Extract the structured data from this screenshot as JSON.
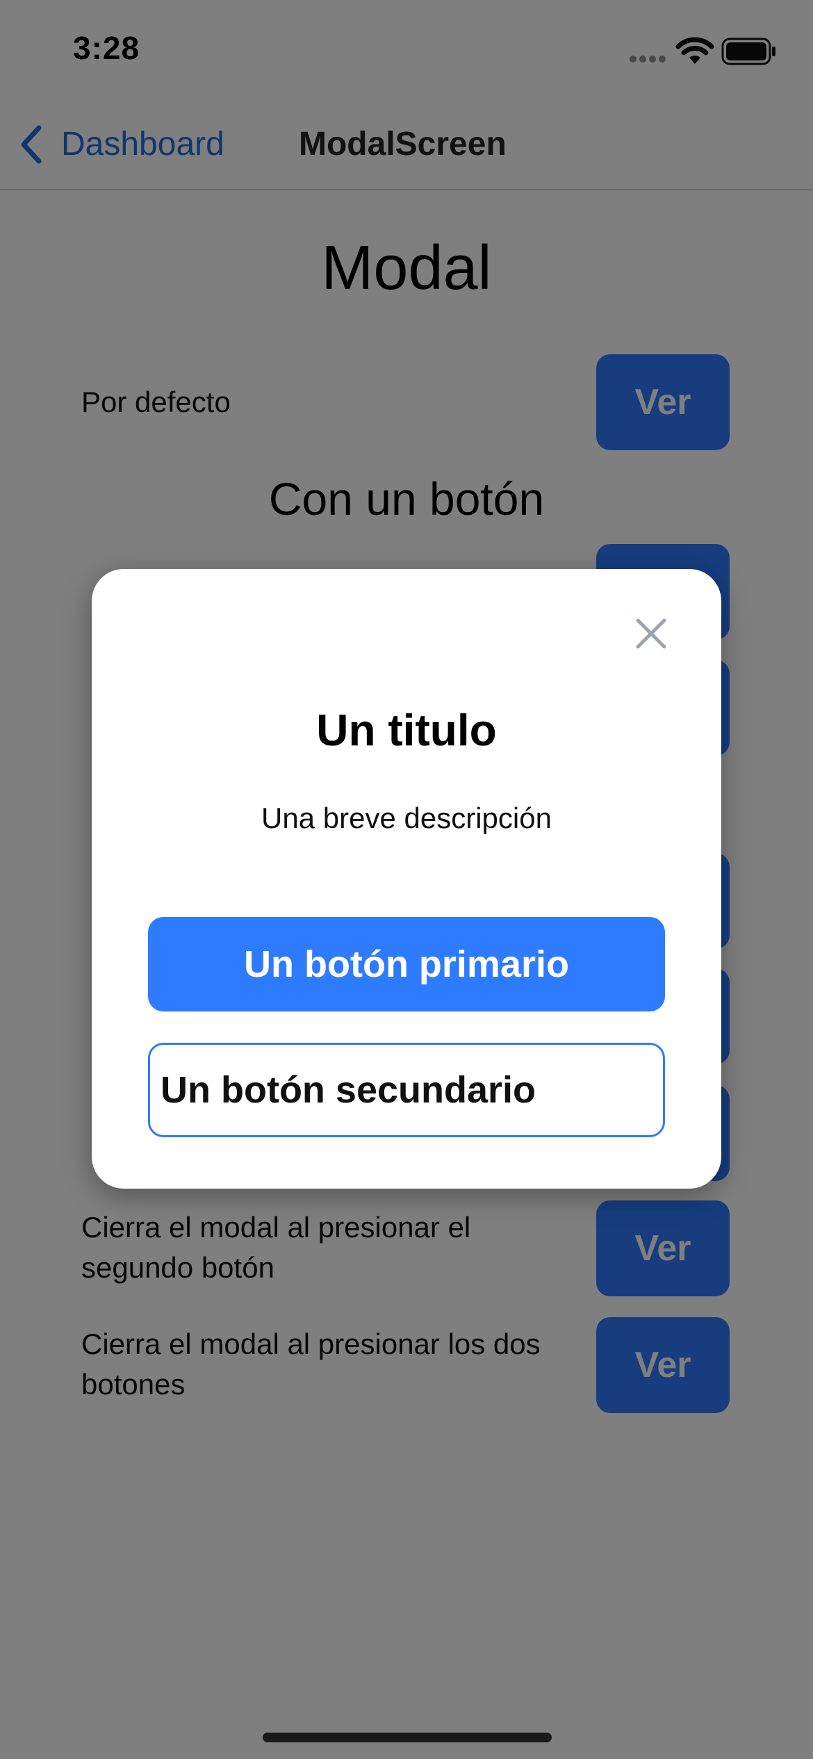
{
  "status_bar": {
    "time": "3:28"
  },
  "nav": {
    "back_label": "Dashboard",
    "title": "ModalScreen"
  },
  "page": {
    "heading": "Modal",
    "section_heading": "Con un botón",
    "rows": [
      {
        "label": "Por defecto",
        "button": "Ver"
      },
      {
        "label": "Cierra el modal al presionar el segundo botón",
        "button": "Ver"
      },
      {
        "label": "Cierra el modal al presionar los dos botones",
        "button": "Ver"
      }
    ]
  },
  "modal": {
    "title": "Un titulo",
    "description": "Una breve descripción",
    "primary_button": "Un botón primario",
    "secondary_button": "Un botón secundario",
    "close_icon": "close-icon"
  },
  "colors": {
    "accent": "#2e7bff",
    "link": "#1f6fdc",
    "overlay": "rgba(0,0,0,0.5)"
  }
}
